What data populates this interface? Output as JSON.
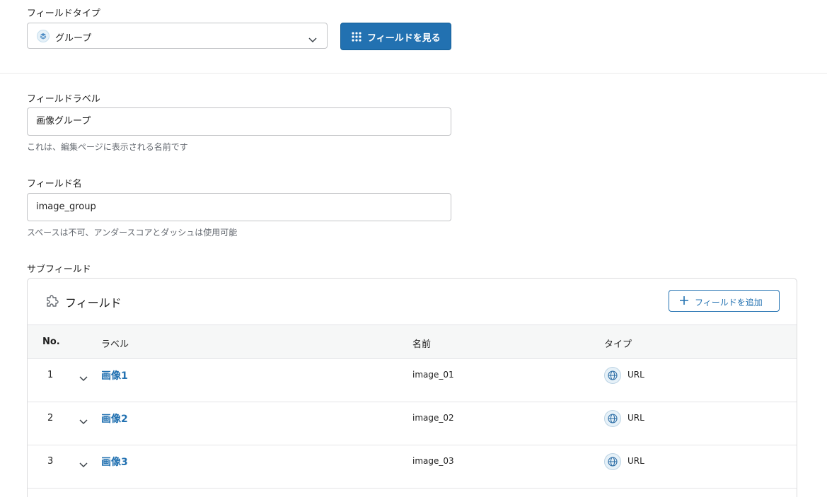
{
  "field_type": {
    "label": "フィールドタイプ",
    "selected": "グループ",
    "browse_label": "フィールドを見る"
  },
  "field_label": {
    "label": "フィールドラベル",
    "value": "画像グループ",
    "help": "これは、編集ページに表示される名前です"
  },
  "field_name": {
    "label": "フィールド名",
    "value": "image_group",
    "help": "スペースは不可、アンダースコアとダッシュは使用可能"
  },
  "sub_fields": {
    "label": "サブフィールド",
    "panel_title": "フィールド",
    "add_label": "フィールドを追加",
    "columns": {
      "no": "No.",
      "label": "ラベル",
      "name": "名前",
      "type": "タイプ"
    },
    "rows": [
      {
        "no": "1",
        "label": "画像1",
        "name": "image_01",
        "type": "URL"
      },
      {
        "no": "2",
        "label": "画像2",
        "name": "image_02",
        "type": "URL"
      },
      {
        "no": "3",
        "label": "画像3",
        "name": "image_03",
        "type": "URL"
      }
    ]
  },
  "colors": {
    "accent": "#2271b1",
    "border": "#c3c4c7",
    "header_bg": "#f6f7f7"
  },
  "icons": {
    "group_type": "layers-icon",
    "browse": "grid-icon",
    "select_caret": "chevron-down-icon",
    "panel": "puzzle-icon",
    "add": "plus-icon",
    "row_toggle": "chevron-down-icon",
    "url_type": "globe-icon"
  }
}
